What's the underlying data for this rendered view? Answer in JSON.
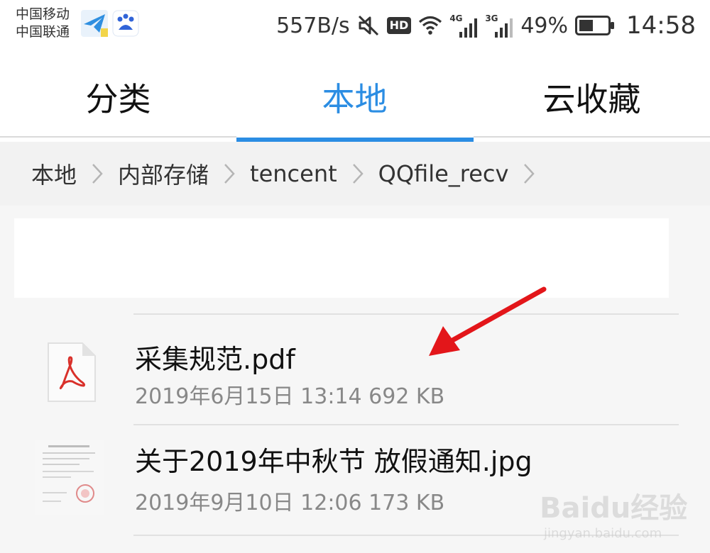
{
  "status_bar": {
    "carrier_1": "中国移动",
    "carrier_2": "中国联通",
    "net_speed": "557B/s",
    "hd_badge": "HD",
    "signal_1_type": "4G",
    "signal_2_type": "3G",
    "battery_pct": "49%",
    "battery_level": 0.49,
    "time": "14:58",
    "icons": [
      "paper-plane-icon",
      "baidu-icon",
      "mute-icon",
      "hd-icon",
      "wifi-icon",
      "signal-icon",
      "battery-icon"
    ]
  },
  "tabs": [
    {
      "label": "分类",
      "active": false
    },
    {
      "label": "本地",
      "active": true
    },
    {
      "label": "云收藏",
      "active": false
    }
  ],
  "breadcrumb": [
    "本地",
    "内部存储",
    "tencent",
    "QQfile_recv"
  ],
  "files": [
    {
      "name": "采集规范.pdf",
      "meta": "2019年6月15日 13:14 692 KB",
      "icon": "pdf-file-icon"
    },
    {
      "name": "关于2019年中秋节 放假通知.jpg",
      "meta": "2019年9月10日 12:06 173 KB",
      "icon": "image-thumbnail"
    }
  ],
  "watermark": {
    "logo": "Baidu经验",
    "url": "jingyan.baidu.com"
  },
  "colors": {
    "accent": "#2b8de3",
    "annotation_arrow": "#e3161a",
    "pdf_red": "#d9302a"
  }
}
